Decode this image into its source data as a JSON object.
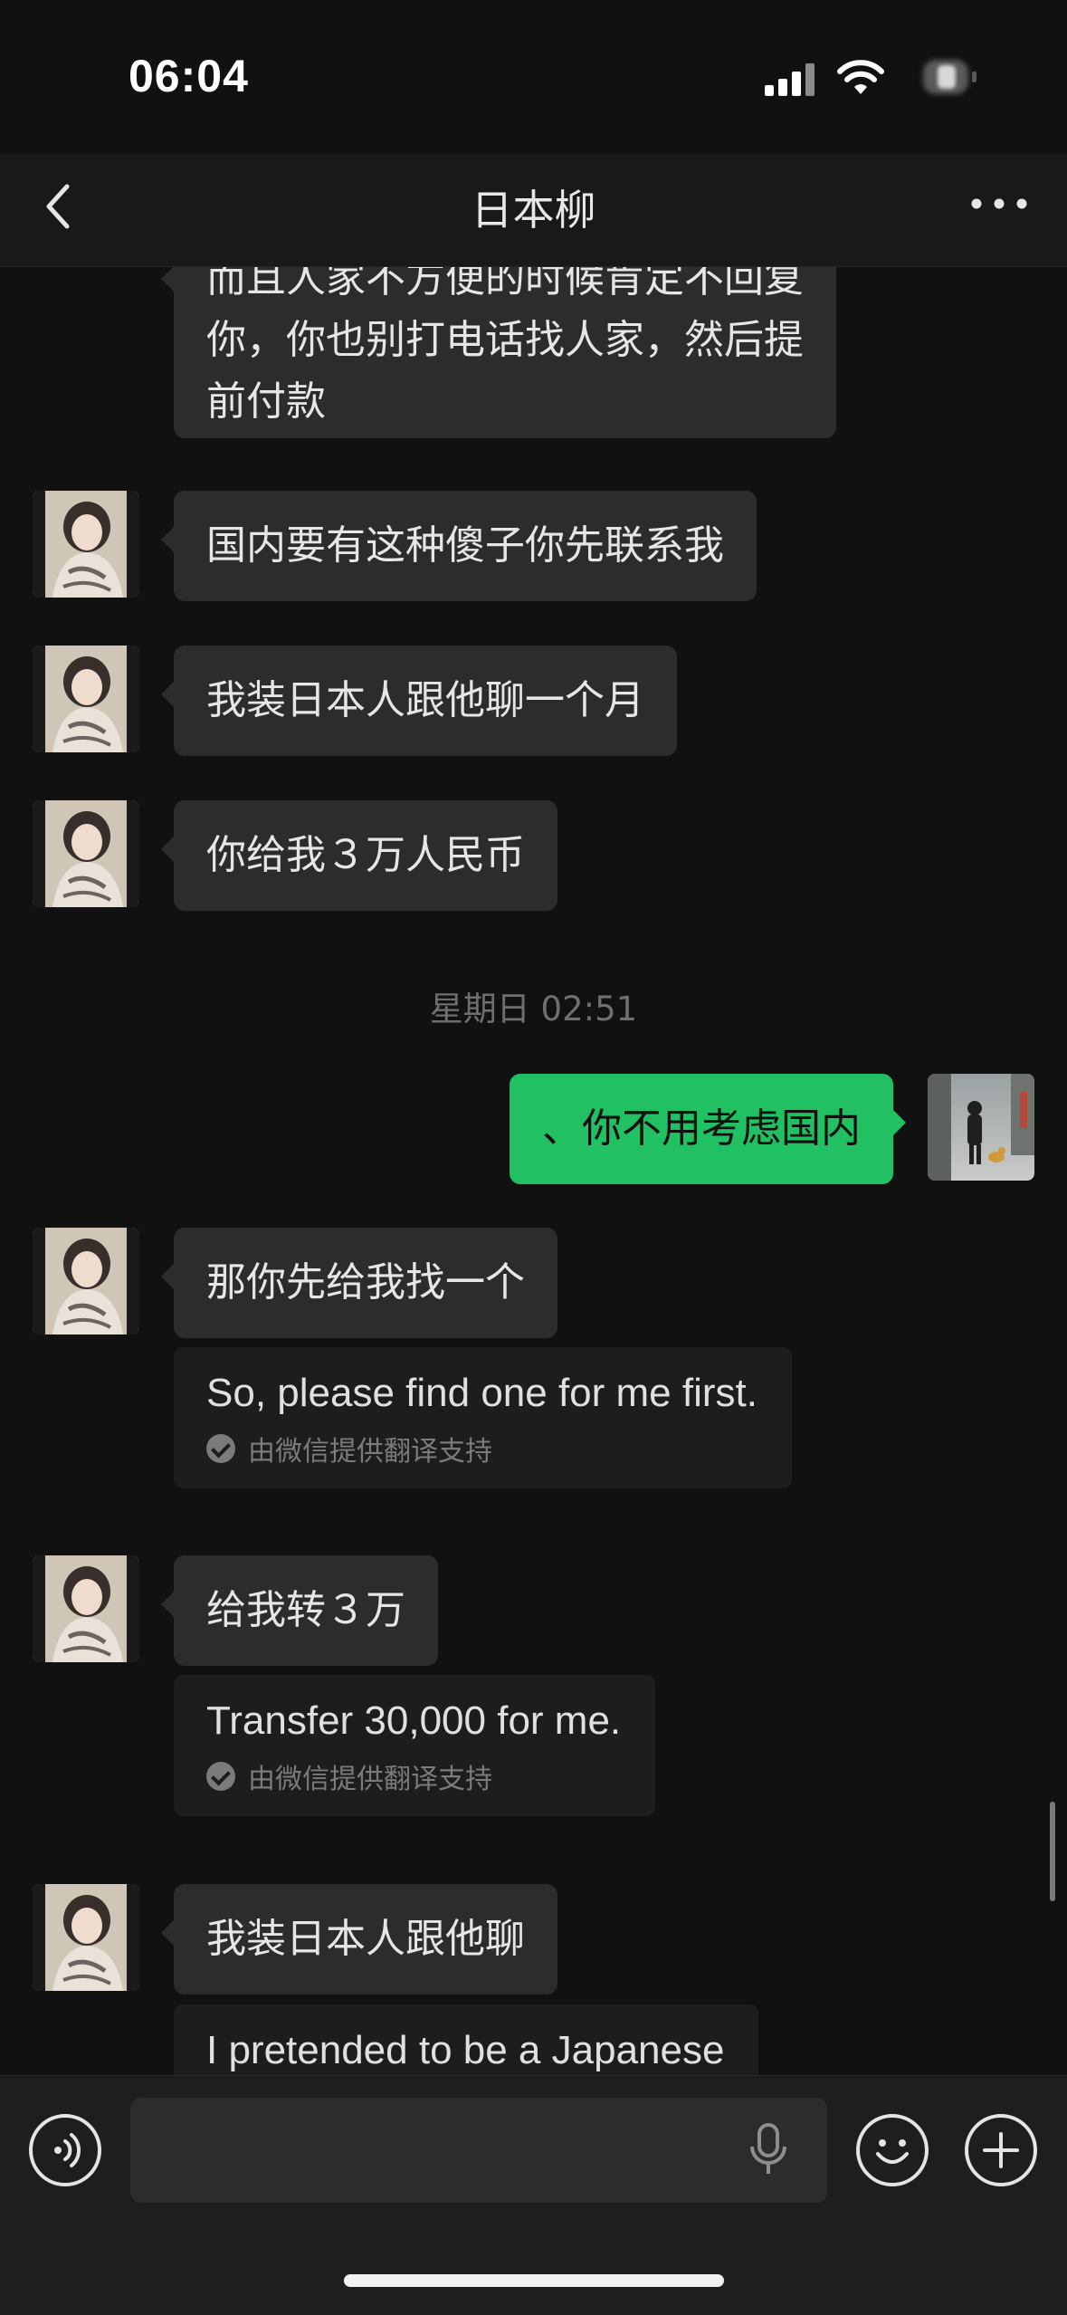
{
  "status_bar": {
    "time": "06:04"
  },
  "nav": {
    "title": "日本柳"
  },
  "messages": [
    {
      "id": "m0",
      "lines": [
        "而且人家不方便的时候肯定不回复",
        "你，你也别打电话找人家，然后提",
        "前付款"
      ]
    },
    {
      "id": "m1",
      "text": "国内要有这种傻子你先联系我"
    },
    {
      "id": "m2",
      "text": "我装日本人跟他聊一个月"
    },
    {
      "id": "m3",
      "text": "你给我３万人民币"
    },
    {
      "id": "ts",
      "text": "星期日 02:51"
    },
    {
      "id": "m4",
      "text": "、你不用考虑国内"
    },
    {
      "id": "m5",
      "text": "那你先给我找一个",
      "translation": "So, please find one for me first.",
      "source": "由微信提供翻译支持"
    },
    {
      "id": "m6",
      "text": "给我转３万",
      "translation": "Transfer 30,000 for me.",
      "source": "由微信提供翻译支持"
    },
    {
      "id": "m7",
      "text": "我装日本人跟他聊",
      "translation": "I pretended to be a Japanese"
    }
  ],
  "colors": {
    "outgoing_bubble": "#21c063",
    "incoming_bubble": "#2c2c2c",
    "background": "#111111"
  },
  "icons": {
    "back": "chevron-left-icon",
    "more": "more-dots-icon",
    "voice": "voice-icon",
    "mic": "microphone-icon",
    "emoji": "emoji-icon",
    "add": "plus-icon"
  }
}
